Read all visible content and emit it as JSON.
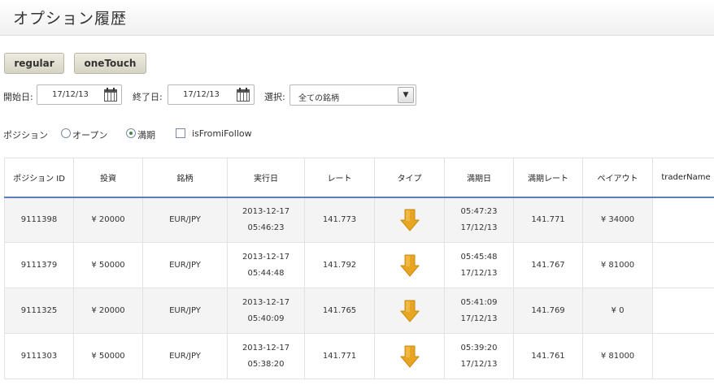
{
  "page": {
    "title": "オプション履歴"
  },
  "tabs": {
    "regular": "regular",
    "onetouch": "oneTouch"
  },
  "filters": {
    "start_label": "開始日:",
    "start_value": "17/12/13",
    "end_label": "終了日:",
    "end_value": "17/12/13",
    "select_label": "選択:",
    "select_value": "全ての銘柄"
  },
  "position": {
    "label": "ポジション",
    "open_label": "オープン",
    "expired_label": "満期",
    "follow_label": "isFromiFollow",
    "selected": "expired"
  },
  "table": {
    "headers": [
      "ポジション ID",
      "投資",
      "銘柄",
      "実行日",
      "レート",
      "タイプ",
      "満期日",
      "満期レート",
      "ペイアウト",
      "traderName"
    ],
    "rows": [
      {
        "id": "9111398",
        "invest": "¥ 20000",
        "symbol": "EUR/JPY",
        "exec_date": "2013-12-17",
        "exec_time": "05:46:23",
        "rate": "141.773",
        "type": "arrow-down-icon",
        "exp_time": "05:47:23",
        "exp_date": "17/12/13",
        "exp_rate": "141.771",
        "payout": "¥ 34000",
        "trader": ""
      },
      {
        "id": "9111379",
        "invest": "¥ 50000",
        "symbol": "EUR/JPY",
        "exec_date": "2013-12-17",
        "exec_time": "05:44:48",
        "rate": "141.792",
        "type": "arrow-down-icon",
        "exp_time": "05:45:48",
        "exp_date": "17/12/13",
        "exp_rate": "141.767",
        "payout": "¥ 81000",
        "trader": ""
      },
      {
        "id": "9111325",
        "invest": "¥ 20000",
        "symbol": "EUR/JPY",
        "exec_date": "2013-12-17",
        "exec_time": "05:40:09",
        "rate": "141.765",
        "type": "arrow-down-icon",
        "exp_time": "05:41:09",
        "exp_date": "17/12/13",
        "exp_rate": "141.769",
        "payout": "¥ 0",
        "trader": ""
      },
      {
        "id": "9111303",
        "invest": "¥ 50000",
        "symbol": "EUR/JPY",
        "exec_date": "2013-12-17",
        "exec_time": "05:38:20",
        "rate": "141.771",
        "type": "arrow-down-icon",
        "exp_time": "05:39:20",
        "exp_date": "17/12/13",
        "exp_rate": "141.761",
        "payout": "¥ 81000",
        "trader": ""
      }
    ]
  },
  "colors": {
    "header_rule": "#5a7fb8",
    "arrow": "#e8a521",
    "radio_dot": "#3a8a3a"
  }
}
